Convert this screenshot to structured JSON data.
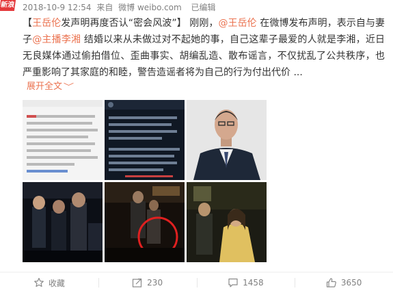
{
  "corner_tag": "新浪",
  "meta": {
    "time": "2018-10-9 12:54",
    "source_prefix": "来自",
    "source": "微博 weibo.com",
    "edited": "已编辑"
  },
  "post": {
    "title_open": "【",
    "title": "王岳伦",
    "title_rest": "发声明再度否认“密会风波”",
    "title_close": "】",
    "seg1": "刚刚，",
    "mention1": "@王岳伦",
    "seg2": " 在微博发布声明，表示自与妻子",
    "mention2": "@主播李湘",
    "seg3": " 结婚以来从未做过对不起她的事，自己这辈子最爱的人就是李湘，近日无良媒体通过偷拍借位、歪曲事实、胡编乱造、散布谣言，不仅扰乱了公共秩序，也严重影响了其家庭的和睦，警告造谣者将为自己的行为付出代价 ..."
  },
  "expand": {
    "label": "展开全文",
    "chevron": "﹀"
  },
  "images": [
    {
      "name": "statement-screenshot-light",
      "caption": "Ouya 8 Plus"
    },
    {
      "name": "statement-screenshot-dark",
      "caption": "何岳伦机构"
    },
    {
      "name": "portrait-photo",
      "caption": ""
    },
    {
      "name": "night-street-photo-1",
      "caption": ""
    },
    {
      "name": "night-street-photo-circled",
      "caption": ""
    },
    {
      "name": "night-street-photo-2",
      "caption": ""
    }
  ],
  "actions": [
    {
      "icon": "star-icon",
      "label": "收藏"
    },
    {
      "icon": "share-icon",
      "label": "230"
    },
    {
      "icon": "comment-icon",
      "label": "1458"
    },
    {
      "icon": "like-icon",
      "label": "3650"
    }
  ],
  "colors": {
    "link": "#eb7350",
    "meta": "#808080",
    "text": "#333333",
    "tag": "#e4393c"
  }
}
